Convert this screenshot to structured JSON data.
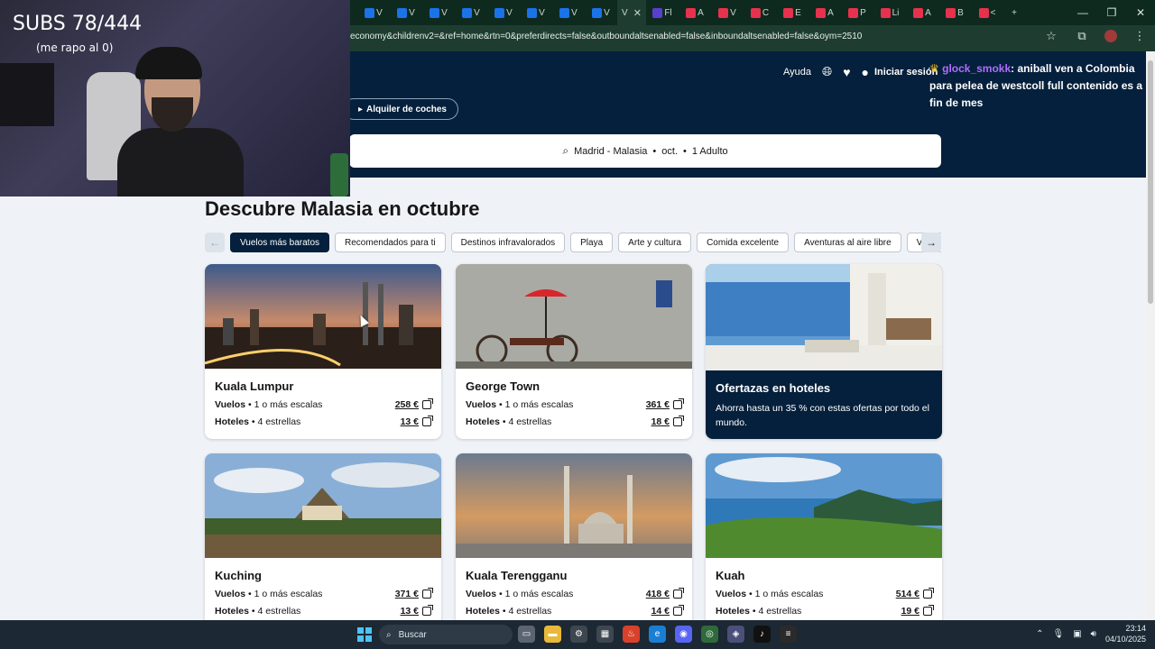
{
  "browser": {
    "url": "economy&childrenv2=&ref=home&rtn=0&preferdirects=false&outboundaltsenabled=false&inboundaltsenabled=false&oym=2510",
    "tabs": [
      "V",
      "V",
      "V",
      "V",
      "V",
      "V",
      "V",
      "V",
      "Fl",
      "A",
      "V",
      "C",
      "E",
      "A",
      "P",
      "Li",
      "A",
      "B",
      "<"
    ],
    "active_tab": "V",
    "new_tab": "+",
    "colors": {
      "tabbar": "#0e2a1f",
      "addressbar": "#1e3d30"
    }
  },
  "stream": {
    "subs": "SUBS 78/444",
    "note": "(me rapo al 0)"
  },
  "chat": {
    "user": "glock_smokk",
    "message": ": aniball ven a Colombia para pelea de westcoll full contenido es a fin de mes"
  },
  "header": {
    "help": "Ayuda",
    "login": "Iniciar sesión",
    "car_rental": "Alquiler de coches",
    "search_summary": {
      "route": "Madrid - Malasia",
      "month": "oct.",
      "travellers": "1 Adulto"
    },
    "brand_color": "#05203c"
  },
  "main": {
    "title": "Descubre Malasia en octubre",
    "chips": [
      "Vuelos más baratos",
      "Recomendados para ti",
      "Destinos infravalorados",
      "Playa",
      "Arte y cultura",
      "Comida excelente",
      "Aventuras al aire libre",
      "Vida nocturna"
    ],
    "selected_chip": "Vuelos más baratos",
    "cards": [
      {
        "name": "Kuala Lumpur",
        "flights_label": "Vuelos",
        "flights_detail": "1 o más escalas",
        "flights_price": "258 €",
        "hotels_label": "Hoteles",
        "hotels_detail": "4 estrellas",
        "hotels_price": "13 €"
      },
      {
        "name": "George Town",
        "flights_label": "Vuelos",
        "flights_detail": "1 o más escalas",
        "flights_price": "361 €",
        "hotels_label": "Hoteles",
        "hotels_detail": "4 estrellas",
        "hotels_price": "18 €"
      },
      {
        "name": "Kuching",
        "flights_label": "Vuelos",
        "flights_detail": "1 o más escalas",
        "flights_price": "371 €",
        "hotels_label": "Hoteles",
        "hotels_detail": "4 estrellas",
        "hotels_price": "13 €"
      },
      {
        "name": "Kuala Terengganu",
        "flights_label": "Vuelos",
        "flights_detail": "1 o más escalas",
        "flights_price": "418 €",
        "hotels_label": "Hoteles",
        "hotels_detail": "4 estrellas",
        "hotels_price": "14 €"
      },
      {
        "name": "Kuah",
        "flights_label": "Vuelos",
        "flights_detail": "1 o más escalas",
        "flights_price": "514 €",
        "hotels_label": "Hoteles",
        "hotels_detail": "4 estrellas",
        "hotels_price": "19 €"
      }
    ],
    "hotel_promo": {
      "title": "Ofertazas en hoteles",
      "text": "Ahorra hasta un 35 % con estas ofertas por todo el mundo."
    }
  },
  "taskbar": {
    "search_placeholder": "Buscar",
    "time": "23:14",
    "date": "04/10/2025"
  }
}
